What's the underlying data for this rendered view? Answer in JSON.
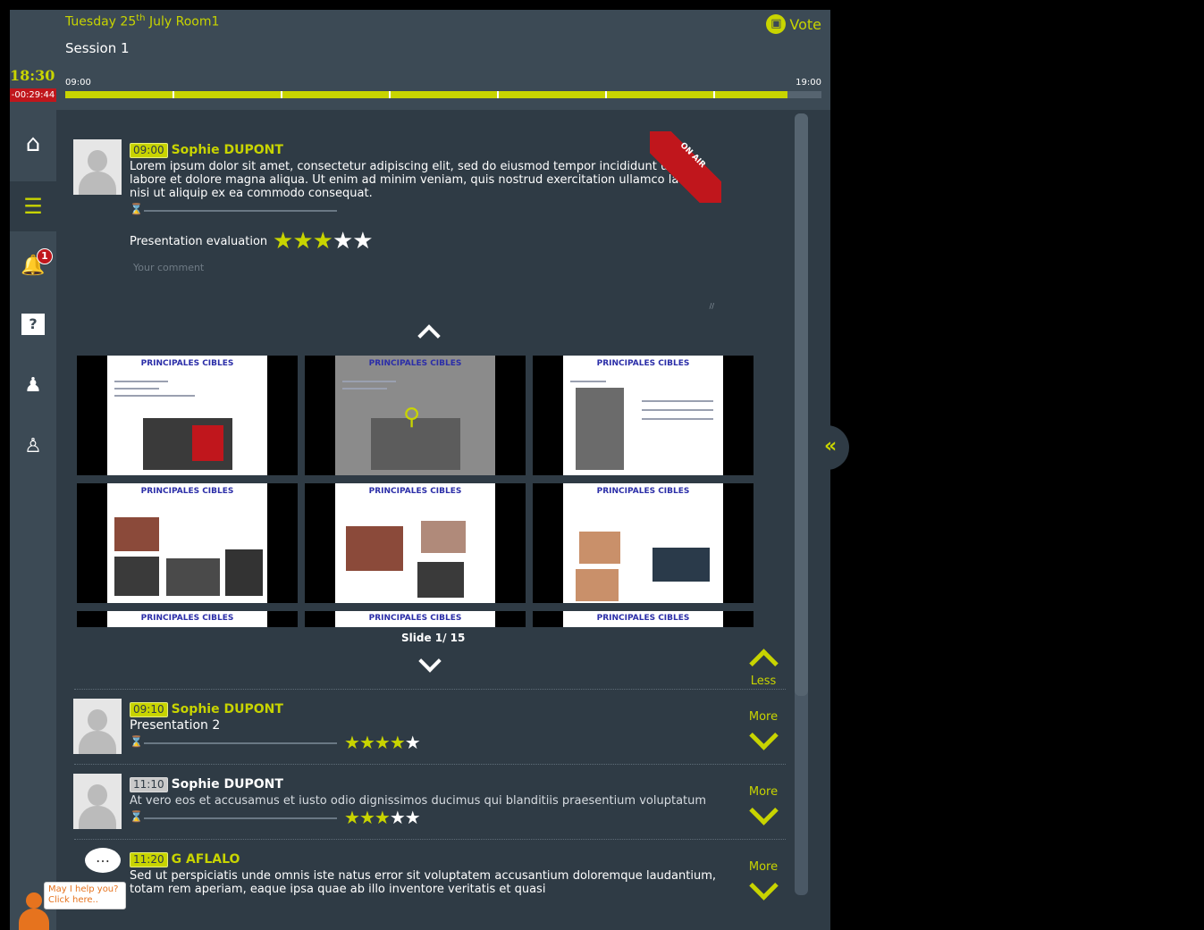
{
  "header": {
    "date_day": "Tuesday 25",
    "date_suffix": "th",
    "date_month": "July",
    "room": "Room1",
    "session": "Session 1",
    "clock": "18:30",
    "countdown": "-00:29:44",
    "timeline_start": "09:00",
    "timeline_end": "19:00",
    "timeline_progress": 0.955,
    "vote_label": "Vote"
  },
  "sidebar": {
    "items": [
      {
        "name": "home-icon"
      },
      {
        "name": "program-list-icon",
        "active": true
      },
      {
        "name": "notification-bell-icon",
        "badge": "1"
      },
      {
        "name": "question-icon"
      },
      {
        "name": "speakers-icon"
      },
      {
        "name": "moderator-icon"
      }
    ]
  },
  "current_talk": {
    "time": "09:00",
    "speaker": "Sophie DUPONT",
    "description": "Lorem ipsum dolor sit amet, consectetur adipiscing elit, sed do eiusmod tempor incididunt ut labore et dolore magna aliqua. Ut enim ad minim veniam, quis nostrud exercitation ullamco laboris nisi ut aliquip ex ea commodo consequat.",
    "status": "ON AIR",
    "evaluation_label": "Presentation evaluation",
    "rating": 3,
    "comment_placeholder": "Your comment",
    "slide_title": "PRINCIPALES CIBLES",
    "slide_counter": "Slide 1/ 15",
    "less_label": "Less"
  },
  "talks": [
    {
      "time": "09:10",
      "speaker": "Sophie DUPONT",
      "description": "Presentation 2",
      "rating": 4,
      "more_label": "More",
      "highlight": true
    },
    {
      "time": "11:10",
      "speaker": "Sophie DUPONT",
      "description": "At vero eos et accusamus et iusto odio dignissimos ducimus qui blanditiis praesentium voluptatum",
      "rating": 3,
      "more_label": "More",
      "highlight": false
    },
    {
      "time": "11:20",
      "speaker": "G AFLALO",
      "description": "Sed ut perspiciatis unde omnis iste natus error sit voluptatem accusantium doloremque laudantium, totam rem aperiam, eaque ipsa quae ab illo inventore veritatis et quasi",
      "rating": 0,
      "more_label": "More",
      "highlight": true
    }
  ],
  "help": {
    "line1": "May I help you?",
    "line2": "Click here.."
  },
  "colors": {
    "accent": "#c8d400",
    "background": "#2f3b45",
    "header": "#3c4a55",
    "alert": "#c0161c"
  }
}
